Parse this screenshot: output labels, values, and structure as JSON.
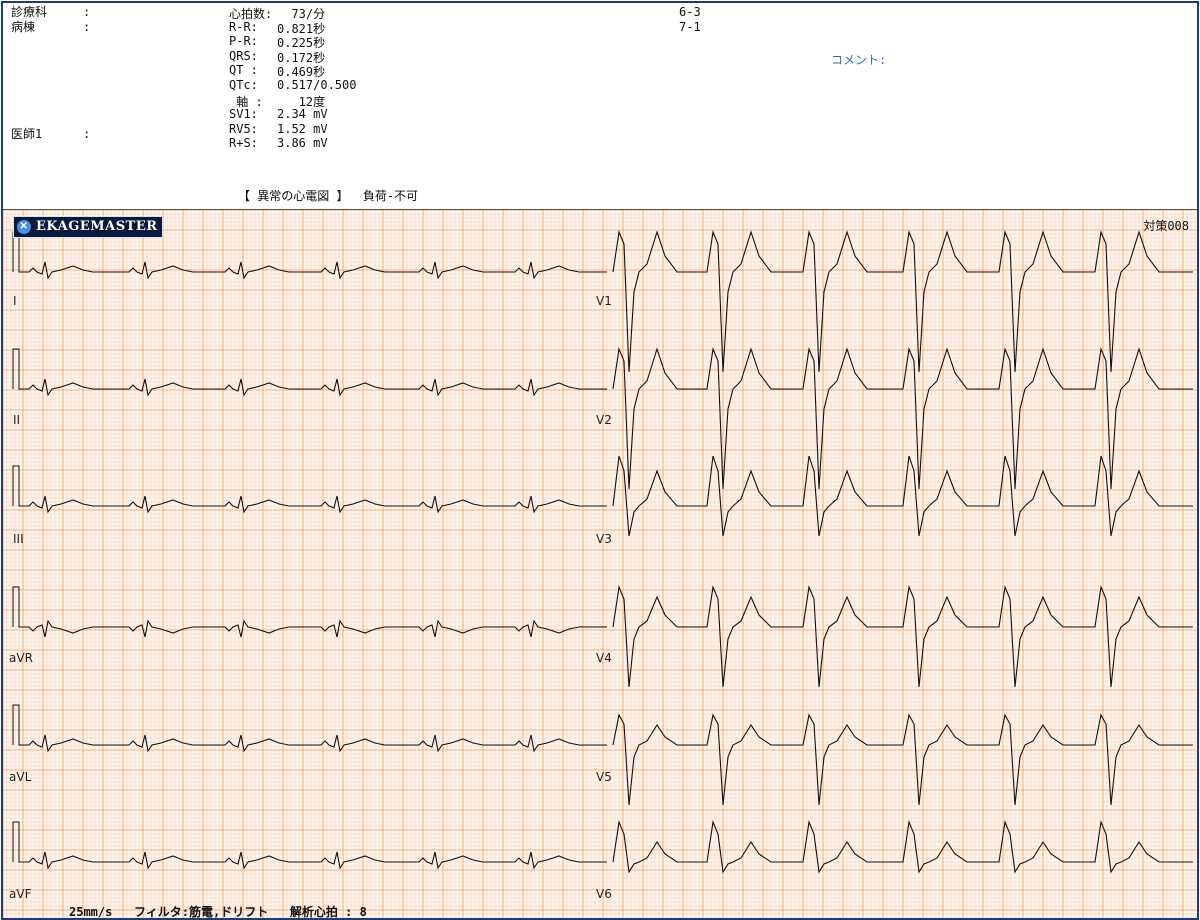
{
  "header": {
    "dept_label": "診療科",
    "ward_label": "病棟",
    "doctor_label": "医師1",
    "colon": ":",
    "params": [
      {
        "label": "心拍数:",
        "value": "  73/分"
      },
      {
        "label": "R-R:",
        "value": "0.821秒"
      },
      {
        "label": "P-R:",
        "value": "0.225秒"
      },
      {
        "label": "QRS:",
        "value": "0.172秒"
      },
      {
        "label": "QT :",
        "value": "0.469秒"
      },
      {
        "label": "QTc:",
        "value": "0.517/0.500"
      },
      {
        "label": " 軸 :",
        "value": "   12度"
      },
      {
        "label": "SV1:",
        "value": "2.34 mV"
      },
      {
        "label": "RV5:",
        "value": "1.52 mV"
      },
      {
        "label": "R+S:",
        "value": "3.86 mV"
      }
    ],
    "code1": "6-3",
    "code2": "7-1",
    "comment_label": "コメント:",
    "diagnosis": "【 異常の心電図 】  負荷-不可"
  },
  "logo": {
    "text": "EKAGEMASTER",
    "icon": "x-circle-icon"
  },
  "record_code": "対策008",
  "leads": {
    "limb": [
      "I",
      "II",
      "III",
      "aVR",
      "aVL",
      "aVF"
    ],
    "chest": [
      "V1",
      "V2",
      "V3",
      "V4",
      "V5",
      "V6"
    ]
  },
  "footer": {
    "text": "25mm/s   フィルタ:筋電,ドリフト   解析心拍 : 8"
  },
  "colors": {
    "grid_minor": "#f9cfb0",
    "grid_major": "#ee9a60",
    "trace": "#111111"
  }
}
